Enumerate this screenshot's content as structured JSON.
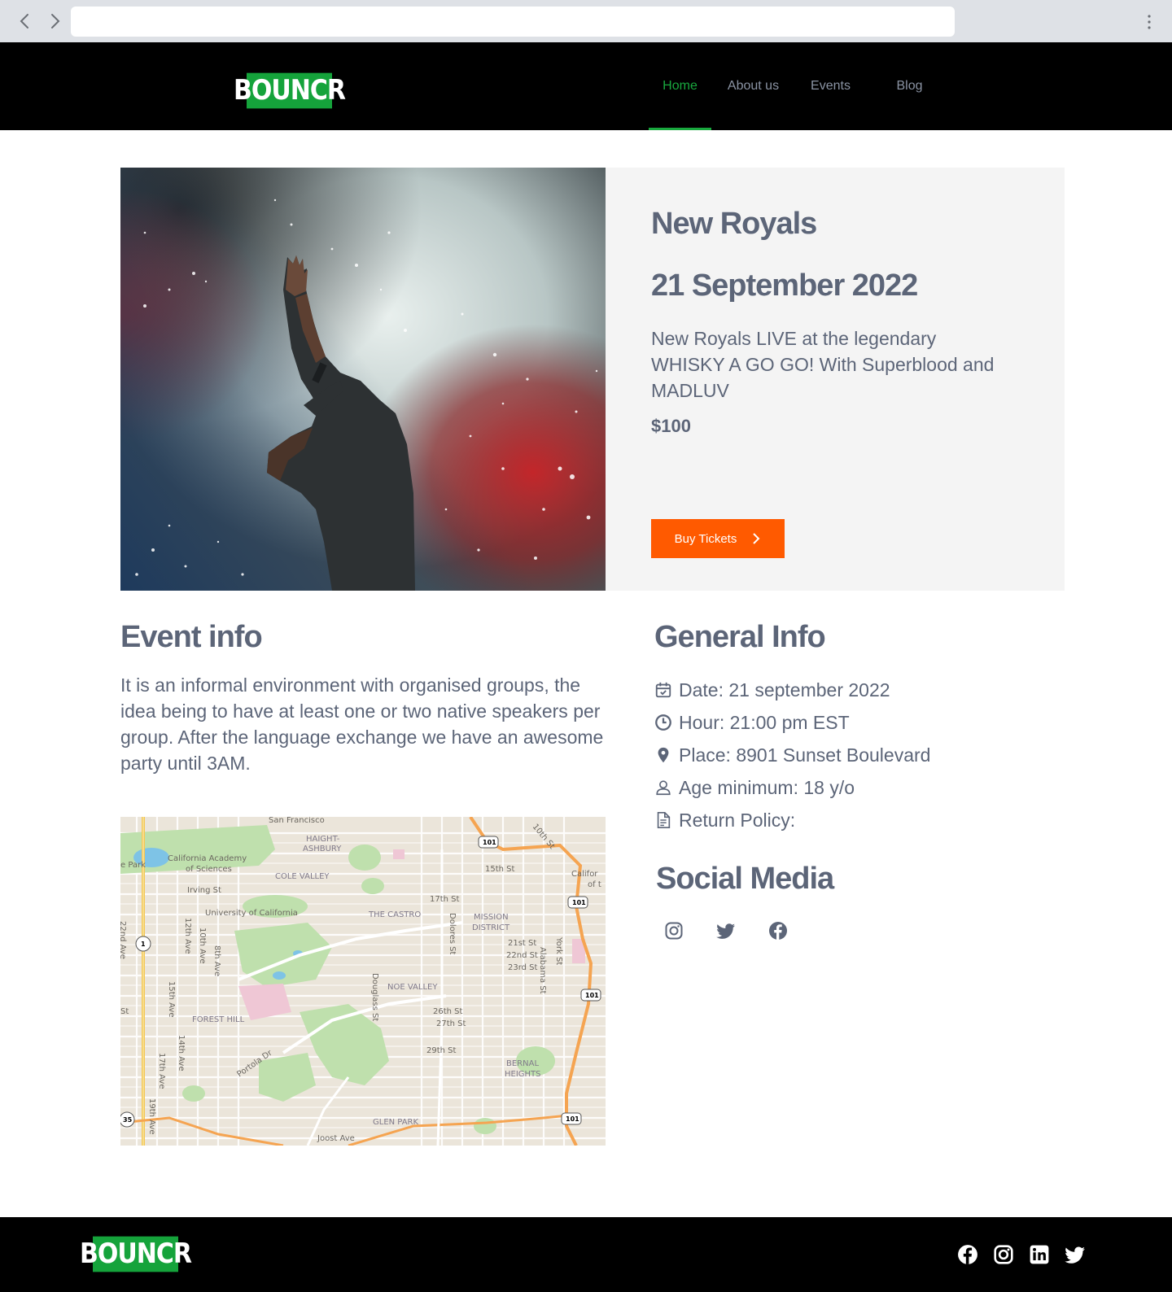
{
  "browser": {
    "url": ""
  },
  "header": {
    "logo_text": "BOUNCR",
    "nav": [
      {
        "label": "Home",
        "active": true
      },
      {
        "label": "About us",
        "active": false
      },
      {
        "label": "Events",
        "active": false
      },
      {
        "label": "Blog",
        "active": false
      }
    ]
  },
  "event": {
    "title": "New Royals",
    "date": "21  September 2022",
    "description": "New Royals LIVE at the legendary WHISKY A GO GO! With Superblood and MADLUV",
    "price": "$100",
    "buy_label": "Buy Tickets"
  },
  "event_info": {
    "title": "Event info",
    "text": "It is an informal environment with organised groups, the idea being to have at least one or two native speakers per group. After the language exchange we have an awesome party until 3AM."
  },
  "map": {
    "labels": [
      "San Francisco",
      "HAIGHT-",
      "ASHBURY",
      "California Academy",
      "of Sciences",
      "e Park",
      "COLE VALLEY",
      "Irving St",
      "University of California",
      "THE CASTRO",
      "MISSION",
      "DISTRICT",
      "17th St",
      "15th St",
      "10th St",
      "Califor",
      "of t",
      "21st St",
      "22nd St",
      "23rd St",
      "Dolores St",
      "Alabama St",
      "York St",
      "NOE VALLEY",
      "Douglass St",
      "12th Ave",
      "10th Ave",
      "8th Ave",
      "15th Ave",
      "FOREST HILL",
      "26th St",
      "27th St",
      "29th St",
      "14th Ave",
      "17th Ave",
      "Portola Dr",
      "BERNAL",
      "HEIGHTS",
      "GLEN PARK",
      "19th Ave",
      "Joost Ave",
      "St",
      "22nd Ave"
    ],
    "shields": [
      "101",
      "101",
      "101",
      "101",
      "1",
      "35"
    ]
  },
  "general_info": {
    "title": "General Info",
    "rows": [
      {
        "icon": "calendar-check-icon",
        "text": "Date: 21 september 2022"
      },
      {
        "icon": "clock-icon",
        "text": "Hour: 21:00 pm EST"
      },
      {
        "icon": "map-pin-icon",
        "text": "Place: 8901 Sunset Boulevard"
      },
      {
        "icon": "user-icon",
        "text": "Age minimum: 18 y/o"
      },
      {
        "icon": "document-icon",
        "text": "Return Policy:"
      }
    ]
  },
  "social": {
    "title": "Social Media",
    "icons": [
      "instagram-icon",
      "twitter-icon",
      "facebook-icon"
    ]
  },
  "footer": {
    "logo_text": "BOUNCR",
    "icons": [
      "facebook-icon",
      "instagram-icon",
      "linkedin-icon",
      "twitter-icon"
    ]
  },
  "colors": {
    "brand_green": "#15a33b",
    "nav_active": "#19a83e",
    "cta_orange": "#ff5a00",
    "text_slate": "#5c6578",
    "panel_gray": "#f4f4f4"
  }
}
